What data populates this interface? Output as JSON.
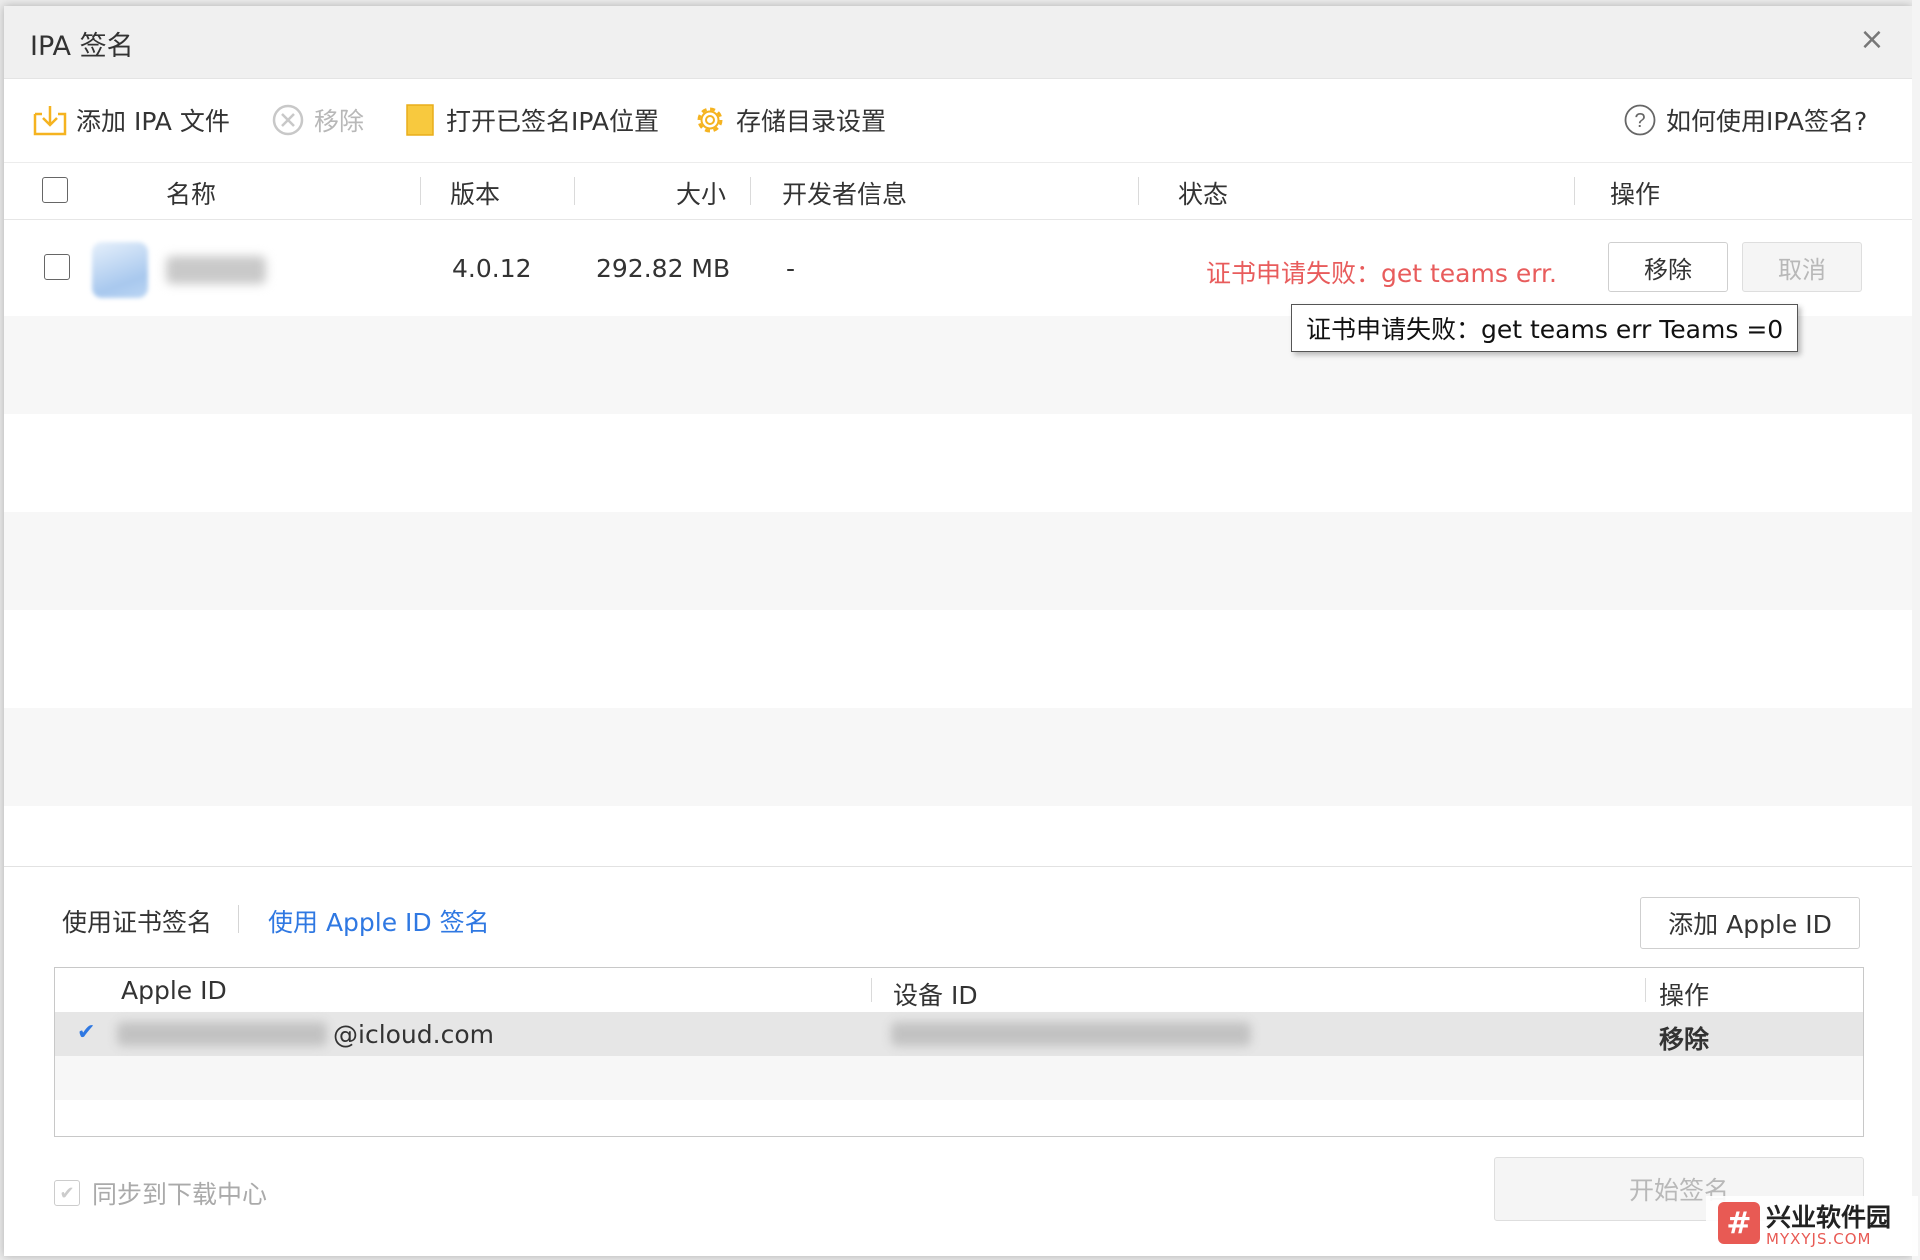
{
  "dialog": {
    "title": "IPA 签名",
    "close_label": "×"
  },
  "toolbar": {
    "add_ipa": "添加 IPA 文件",
    "remove": "移除",
    "open_signed": "打开已签名IPA位置",
    "storage_settings": "存储目录设置",
    "help": "如何使用IPA签名?"
  },
  "columns": {
    "name": "名称",
    "version": "版本",
    "size": "大小",
    "developer": "开发者信息",
    "status": "状态",
    "action": "操作"
  },
  "files": [
    {
      "version": "4.0.12",
      "size": "292.82 MB",
      "developer": "-",
      "status": "证书申请失败：get teams err....",
      "remove_label": "移除",
      "cancel_label": "取消"
    }
  ],
  "tooltip": {
    "text": "证书申请失败：get teams err Teams =0"
  },
  "signing": {
    "tab_cert": "使用证书签名",
    "tab_apple_id": "使用 Apple ID 签名",
    "add_apple_id": "添加 Apple ID",
    "table_headers": {
      "apple_id": "Apple ID",
      "device_id": "设备 ID",
      "action": "操作"
    },
    "accounts": [
      {
        "apple_id_suffix": "@icloud.com",
        "action": "移除",
        "selected": true
      }
    ],
    "sync_label": "同步到下载中心",
    "start_label": "开始签名"
  },
  "watermark": {
    "title": "兴业软件园",
    "url": "MYXYJS.COM"
  },
  "colors": {
    "accent_blue": "#2f78e2",
    "error_red": "#e85c5c",
    "icon_yellow": "#f5b320"
  }
}
